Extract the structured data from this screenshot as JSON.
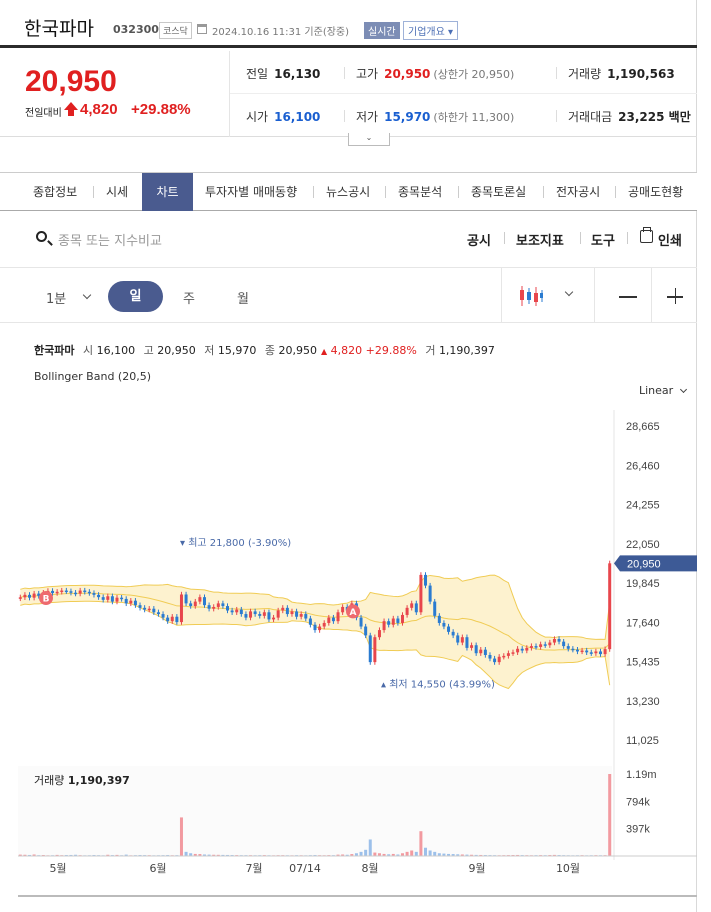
{
  "header": {
    "company": "한국파마",
    "code": "032300",
    "market": "코스닥",
    "as_of": "2024.10.16 11:31 기준(장중)",
    "realtime_badge": "실시간",
    "company_info_btn": "기업개요 ▾"
  },
  "price": {
    "current": "20,950",
    "change_label": "전일대비",
    "change": "4,820",
    "change_pct": "+29.88%"
  },
  "stats": {
    "prev_close_label": "전일",
    "prev_close": "16,130",
    "high_label": "고가",
    "high": "20,950",
    "upper_limit": "(상한가 20,950)",
    "volume_label": "거래량",
    "volume": "1,190,563",
    "open_label": "시가",
    "open": "16,100",
    "low_label": "저가",
    "low": "15,970",
    "lower_limit": "(하한가 11,300)",
    "amount_label": "거래대금",
    "amount": "23,225 백만"
  },
  "tabs": [
    "종합정보",
    "시세",
    "차트",
    "투자자별 매매동향",
    "뉴스공시",
    "종목분석",
    "종목토론실",
    "전자공시",
    "공매도현황"
  ],
  "toolbar": {
    "search_placeholder": "종목 또는 지수비교",
    "disclosure": "공시",
    "indicators": "보조지표",
    "tools": "도구",
    "print": "인쇄"
  },
  "periods": {
    "minute": "1분",
    "day": "일",
    "week": "주",
    "month": "월"
  },
  "chart_info": {
    "name": "한국파마",
    "open_label": "시",
    "open": "16,100",
    "high_label": "고",
    "high": "20,950",
    "low_label": "저",
    "low": "15,970",
    "close_label": "종",
    "close": "20,950",
    "change": "4,820",
    "change_pct": "+29.88%",
    "volume_label": "거",
    "volume": "1,190,397",
    "indicator": "Bollinger Band (20,5)",
    "scale": "Linear"
  },
  "volume_panel": {
    "label": "거래량",
    "value": "1,190,397"
  },
  "colors": {
    "up": "#e8464c",
    "down": "#2a7bd0",
    "band_fill": "#fdf2cf",
    "band_line": "#f0cc55",
    "accent": "#4a5b8f"
  },
  "chart_data": {
    "type": "candlestick",
    "y_ticks": [
      "28,665",
      "26,460",
      "24,255",
      "22,050",
      "19,845",
      "17,640",
      "15,435",
      "13,230",
      "11,025"
    ],
    "ylim": [
      11025,
      28665
    ],
    "last_price_label": "20,950",
    "volume_ticks": [
      "1.19m",
      "794k",
      "397k"
    ],
    "x_labels": [
      "5월",
      "6월",
      "7월",
      "07/14",
      "8월",
      "9월",
      "10월"
    ],
    "annotations": {
      "high": "최고 21,800 (-3.90%)",
      "low": "최저 14,550 (43.99%)",
      "marker_b": "B",
      "marker_a": "A"
    },
    "closes": [
      19040,
      19180,
      19020,
      19250,
      19120,
      19300,
      19400,
      19280,
      19350,
      19420,
      19380,
      19300,
      19250,
      19420,
      19350,
      19280,
      19180,
      19050,
      18900,
      19100,
      18800,
      19020,
      18950,
      18700,
      18850,
      18600,
      18450,
      18350,
      18400,
      18200,
      18100,
      17900,
      17700,
      17950,
      17650,
      19200,
      18700,
      18550,
      18800,
      19050,
      18600,
      18400,
      18500,
      18700,
      18550,
      18300,
      18200,
      18350,
      18100,
      17900,
      18250,
      18100,
      18000,
      18200,
      17800,
      17900,
      18300,
      18450,
      18100,
      18250,
      17950,
      18100,
      17850,
      17500,
      17200,
      17400,
      17600,
      17900,
      17700,
      18200,
      18500,
      18300,
      18700,
      17900,
      17400,
      16900,
      15400,
      16800,
      17200,
      17700,
      17500,
      17850,
      17600,
      18050,
      18450,
      18700,
      18200,
      20300,
      19700,
      18800,
      18000,
      17600,
      17400,
      17100,
      16900,
      16500,
      16800,
      16200,
      16350,
      15900,
      16100,
      15800,
      15600,
      15400,
      15700,
      15750,
      15900,
      15950,
      16150,
      16050,
      16200,
      16300,
      16250,
      16400,
      16350,
      16500,
      16700,
      16550,
      16300,
      16150,
      16100,
      16000,
      16050,
      15950,
      15900,
      16000,
      15850,
      16130,
      20950
    ],
    "volumes_k": [
      20,
      18,
      15,
      22,
      12,
      14,
      10,
      11,
      16,
      12,
      14,
      15,
      18,
      12,
      10,
      11,
      14,
      12,
      10,
      18,
      13,
      16,
      11,
      20,
      10,
      12,
      14,
      13,
      12,
      10,
      11,
      12,
      14,
      11,
      12,
      560,
      60,
      40,
      30,
      28,
      22,
      20,
      18,
      17,
      16,
      15,
      14,
      13,
      12,
      12,
      12,
      11,
      12,
      13,
      11,
      10,
      12,
      12,
      11,
      10,
      12,
      11,
      10,
      12,
      14,
      12,
      11,
      13,
      12,
      20,
      22,
      18,
      28,
      40,
      60,
      90,
      240,
      50,
      40,
      30,
      25,
      30,
      22,
      40,
      60,
      80,
      60,
      360,
      120,
      80,
      60,
      40,
      35,
      30,
      28,
      25,
      22,
      20,
      18,
      16,
      15,
      14,
      13,
      12,
      11,
      12,
      13,
      14,
      15,
      13,
      12,
      11,
      12,
      13,
      12,
      14,
      16,
      14,
      12,
      11,
      10,
      11,
      12,
      10,
      11,
      12,
      11,
      12,
      1190
    ]
  }
}
